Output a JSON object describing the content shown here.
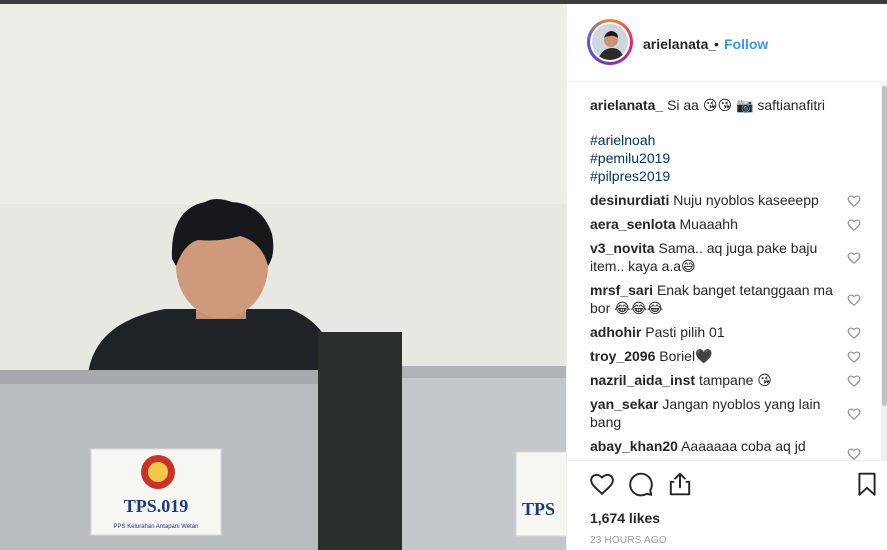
{
  "post": {
    "username": "arielanata_",
    "separator": "•",
    "follow_label": "Follow",
    "caption_text": "Si aa",
    "caption_emojis": [
      "😘",
      "😘"
    ],
    "camera_icon": "📷",
    "photo_credit": "saftianafitri",
    "hashtags": [
      "#arielnoah",
      "#pemilu2019",
      "#pilpres2019"
    ],
    "likes": "1,674 likes",
    "timestamp": "23 HOURS AGO"
  },
  "photo": {
    "left_sign": "TPS.019",
    "left_sign_small": "PPS Kelurahan Antapani Wetan",
    "right_sign": "TPS"
  },
  "comments": [
    {
      "user": "desinurdiati",
      "text": "Nuju nyoblos kaseeepp"
    },
    {
      "user": "aera_senlota",
      "text": "Muaaahh"
    },
    {
      "user": "v3_novita",
      "text": "Sama.. aq juga pake baju item.. kaya a.a😅"
    },
    {
      "user": "mrsf_sari",
      "text": "Enak banget tetanggaan ma bor 😂😂😂"
    },
    {
      "user": "adhohir",
      "text": "Pasti pilih 01"
    },
    {
      "user": "troy_2096",
      "text": "Boriel🖤"
    },
    {
      "user": "nazril_aida_inst",
      "text": "tampane 😘"
    },
    {
      "user": "yan_sekar",
      "text": "Jangan nyoblos yang lain bang"
    },
    {
      "user": "abay_khan20",
      "text": "Aaaaaaa coba aq jd"
    }
  ],
  "icons": {
    "like": "heart-icon",
    "comment": "comment-icon",
    "share": "share-icon",
    "save": "bookmark-icon"
  }
}
